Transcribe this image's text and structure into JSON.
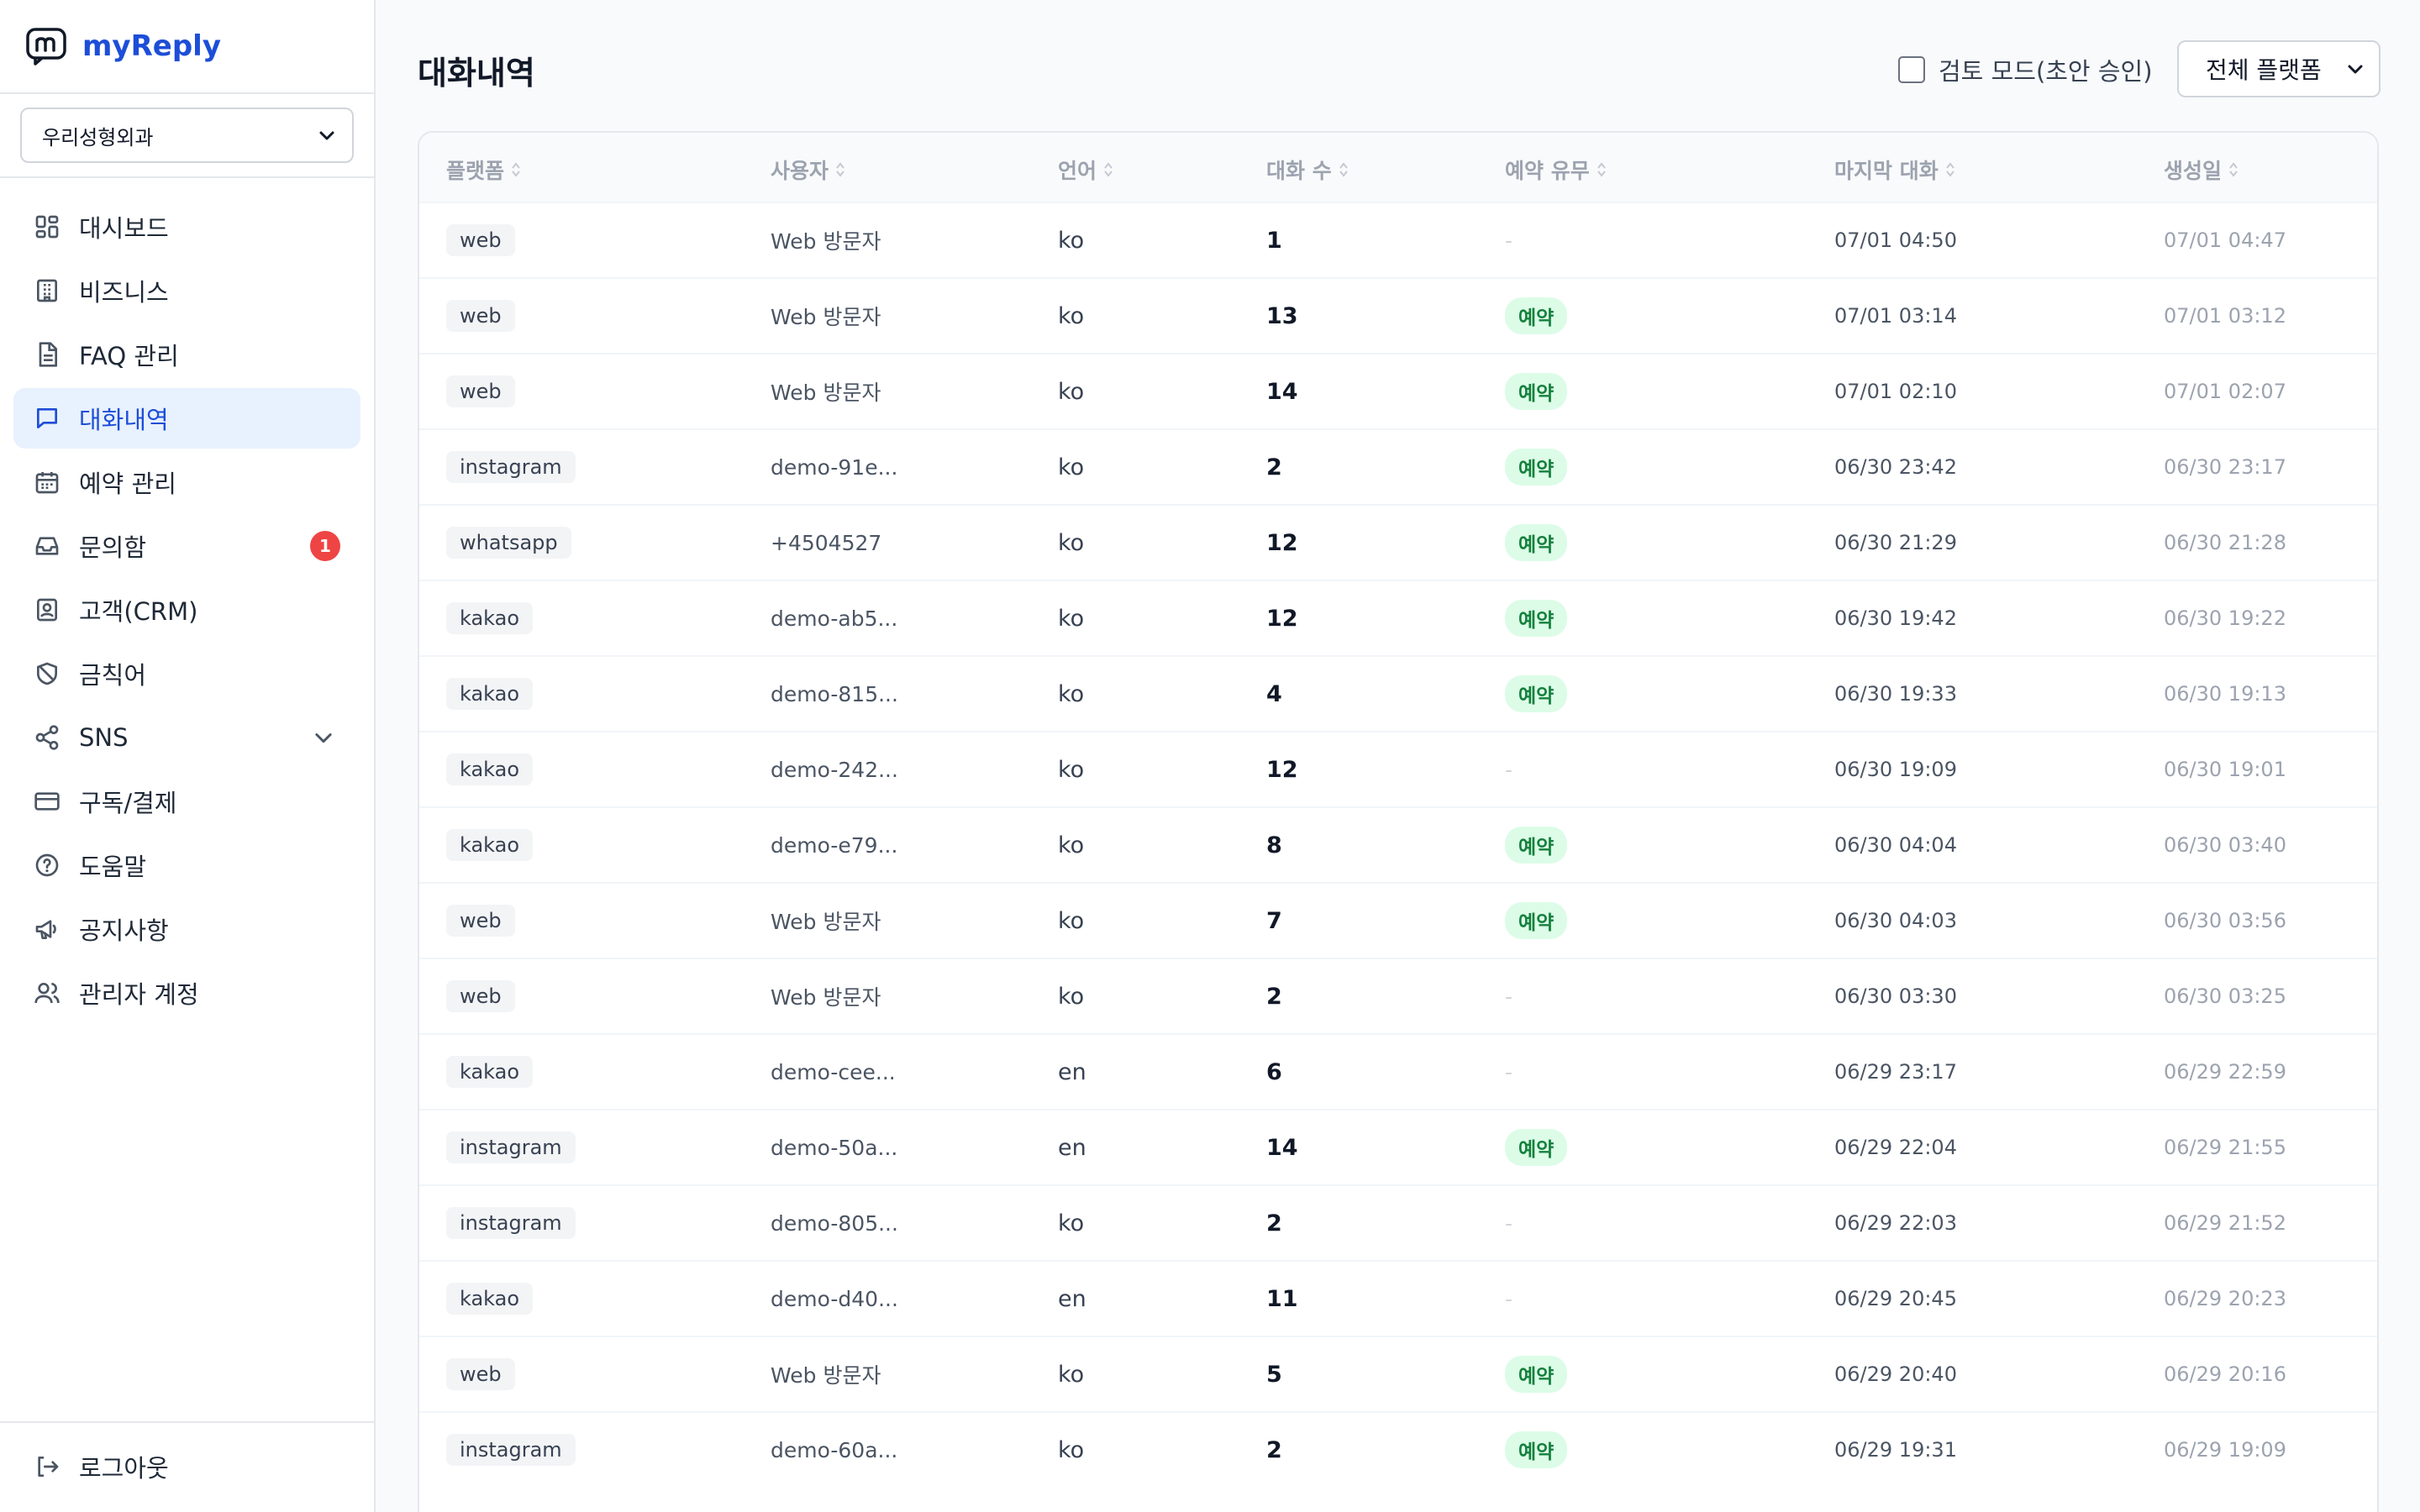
{
  "app": {
    "name": "myReply"
  },
  "business_select": {
    "value": "우리성형외과"
  },
  "sidebar": {
    "items": [
      {
        "label": "대시보드",
        "icon": "dashboard-icon",
        "active": false
      },
      {
        "label": "비즈니스",
        "icon": "building-icon",
        "active": false
      },
      {
        "label": "FAQ 관리",
        "icon": "document-icon",
        "active": false
      },
      {
        "label": "대화내역",
        "icon": "chat-icon",
        "active": true
      },
      {
        "label": "예약 관리",
        "icon": "calendar-icon",
        "active": false
      },
      {
        "label": "문의함",
        "icon": "inbox-icon",
        "active": false,
        "badge": "1"
      },
      {
        "label": "고객(CRM)",
        "icon": "contact-icon",
        "active": false
      },
      {
        "label": "금칙어",
        "icon": "shield-icon",
        "active": false
      },
      {
        "label": "SNS",
        "icon": "share-icon",
        "active": false
      },
      {
        "label": "구독/결제",
        "icon": "card-icon",
        "active": false
      },
      {
        "label": "도움말",
        "icon": "help-icon",
        "active": false
      },
      {
        "label": "공지사항",
        "icon": "megaphone-icon",
        "active": false
      },
      {
        "label": "관리자 계정",
        "icon": "users-icon",
        "active": false
      }
    ],
    "logout_label": "로그아웃"
  },
  "header": {
    "title": "대화내역",
    "review_mode_label": "검토 모드(초안 승인)",
    "platform_filter": "전체 플랫폼"
  },
  "table": {
    "columns": [
      "플랫폼",
      "사용자",
      "언어",
      "대화 수",
      "예약 유무",
      "마지막 대화",
      "생성일"
    ],
    "rows": [
      {
        "platform": "web",
        "user": "Web 방문자",
        "lang": "ko",
        "count": "1",
        "reserved": "-",
        "last": "07/01 04:50",
        "created": "07/01 04:47"
      },
      {
        "platform": "web",
        "user": "Web 방문자",
        "lang": "ko",
        "count": "13",
        "reserved": "예약",
        "last": "07/01 03:14",
        "created": "07/01 03:12"
      },
      {
        "platform": "web",
        "user": "Web 방문자",
        "lang": "ko",
        "count": "14",
        "reserved": "예약",
        "last": "07/01 02:10",
        "created": "07/01 02:07"
      },
      {
        "platform": "instagram",
        "user": "demo-91e...",
        "lang": "ko",
        "count": "2",
        "reserved": "예약",
        "last": "06/30 23:42",
        "created": "06/30 23:17"
      },
      {
        "platform": "whatsapp",
        "user": "+4504527",
        "lang": "ko",
        "count": "12",
        "reserved": "예약",
        "last": "06/30 21:29",
        "created": "06/30 21:28"
      },
      {
        "platform": "kakao",
        "user": "demo-ab5...",
        "lang": "ko",
        "count": "12",
        "reserved": "예약",
        "last": "06/30 19:42",
        "created": "06/30 19:22"
      },
      {
        "platform": "kakao",
        "user": "demo-815...",
        "lang": "ko",
        "count": "4",
        "reserved": "예약",
        "last": "06/30 19:33",
        "created": "06/30 19:13"
      },
      {
        "platform": "kakao",
        "user": "demo-242...",
        "lang": "ko",
        "count": "12",
        "reserved": "-",
        "last": "06/30 19:09",
        "created": "06/30 19:01"
      },
      {
        "platform": "kakao",
        "user": "demo-e79...",
        "lang": "ko",
        "count": "8",
        "reserved": "예약",
        "last": "06/30 04:04",
        "created": "06/30 03:40"
      },
      {
        "platform": "web",
        "user": "Web 방문자",
        "lang": "ko",
        "count": "7",
        "reserved": "예약",
        "last": "06/30 04:03",
        "created": "06/30 03:56"
      },
      {
        "platform": "web",
        "user": "Web 방문자",
        "lang": "ko",
        "count": "2",
        "reserved": "-",
        "last": "06/30 03:30",
        "created": "06/30 03:25"
      },
      {
        "platform": "kakao",
        "user": "demo-cee...",
        "lang": "en",
        "count": "6",
        "reserved": "-",
        "last": "06/29 23:17",
        "created": "06/29 22:59"
      },
      {
        "platform": "instagram",
        "user": "demo-50a...",
        "lang": "en",
        "count": "14",
        "reserved": "예약",
        "last": "06/29 22:04",
        "created": "06/29 21:55"
      },
      {
        "platform": "instagram",
        "user": "demo-805...",
        "lang": "ko",
        "count": "2",
        "reserved": "-",
        "last": "06/29 22:03",
        "created": "06/29 21:52"
      },
      {
        "platform": "kakao",
        "user": "demo-d40...",
        "lang": "en",
        "count": "11",
        "reserved": "-",
        "last": "06/29 20:45",
        "created": "06/29 20:23"
      },
      {
        "platform": "web",
        "user": "Web 방문자",
        "lang": "ko",
        "count": "5",
        "reserved": "예약",
        "last": "06/29 20:40",
        "created": "06/29 20:16"
      },
      {
        "platform": "instagram",
        "user": "demo-60a...",
        "lang": "ko",
        "count": "2",
        "reserved": "예약",
        "last": "06/29 19:31",
        "created": "06/29 19:09"
      }
    ]
  },
  "colors": {
    "accent": "#1d4ed8",
    "active_bg": "#e8f1fe",
    "badge": "#ef4444",
    "reserved_bg": "#dcfce7",
    "reserved_text": "#15803d"
  }
}
